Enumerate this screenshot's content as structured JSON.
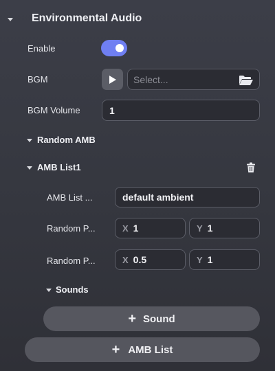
{
  "section": {
    "title": "Environmental Audio"
  },
  "enable": {
    "label": "Enable",
    "on": true
  },
  "bgm": {
    "label": "BGM",
    "placeholder": "Select..."
  },
  "bgm_volume": {
    "label": "BGM Volume",
    "value": "1"
  },
  "random_amb": {
    "title": "Random AMB"
  },
  "amb_list1": {
    "title": "AMB List1",
    "name_label": "AMB List ...",
    "name_value": "default ambient",
    "row1": {
      "label": "Random P...",
      "x_axis": "X",
      "x_value": "1",
      "y_axis": "Y",
      "y_value": "1"
    },
    "row2": {
      "label": "Random P...",
      "x_axis": "X",
      "x_value": "0.5",
      "y_axis": "Y",
      "y_value": "1"
    },
    "sounds_title": "Sounds"
  },
  "add_sound_label": "Sound",
  "add_amb_list_label": "AMB List",
  "colors": {
    "accent": "#6f7ff2",
    "field_bg": "#2b2c33",
    "field_border": "#5b5d67"
  }
}
